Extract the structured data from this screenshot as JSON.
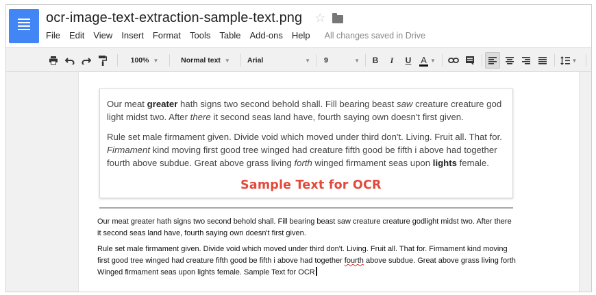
{
  "document": {
    "title": "ocr-image-text-extraction-sample-text.png",
    "save_status": "All changes saved in Drive"
  },
  "menu": [
    "File",
    "Edit",
    "View",
    "Insert",
    "Format",
    "Tools",
    "Table",
    "Add-ons",
    "Help"
  ],
  "toolbar": {
    "zoom": "100%",
    "style": "Normal text",
    "font": "Arial",
    "font_size": "9",
    "bold": "B",
    "italic": "I",
    "underline": "U",
    "text_color": "A",
    "accent_color": "#4285f4",
    "icons": [
      "print-icon",
      "undo-icon",
      "redo-icon",
      "paint-format-icon",
      "bold-icon",
      "italic-icon",
      "underline-icon",
      "text-color-icon",
      "link-icon",
      "comment-icon",
      "align-left-icon",
      "align-center-icon",
      "align-right-icon",
      "justify-icon",
      "line-spacing-icon"
    ]
  },
  "sample_image": {
    "para1": {
      "a": "Our meat ",
      "b": "greater",
      "c": " hath signs two second behold shall. Fill bearing beast ",
      "d": "saw",
      "e": " creature creature god light midst two. After ",
      "f": "there",
      "g": " it second seas land have, fourth saying own doesn't first given."
    },
    "para2": {
      "a": "Rule set male firmament given. Divide void which moved under third don't. Living. Fruit all. That for. ",
      "b": "Firmament",
      "c": " kind moving first good tree winged had creature fifth good be fifth i above had together fourth above subdue. Great above grass living ",
      "d": "forth",
      "e": " winged firmament seas upon ",
      "f": "lights",
      "g": " female."
    },
    "heading": "Sample Text for OCR",
    "heading_color": "#e24a3b"
  },
  "extracted": {
    "para1": "Our meat greater hath signs two second behold shall. Fill bearing beast saw creature creature godlight midst two. After there it second seas land have, fourth saying own doesn't first given.",
    "para2_a": "Rule set male firmament given. Divide void which moved under third don't. Living. Fruit all. That for. Firmament kind moving first good tree winged had creature fifth good be fifth i above had together ",
    "para2_misspelled": "fourth",
    "para2_b": " above subdue. Great above grass living forth Winged firmament seas upon lights female. Sample Text for OCR"
  }
}
